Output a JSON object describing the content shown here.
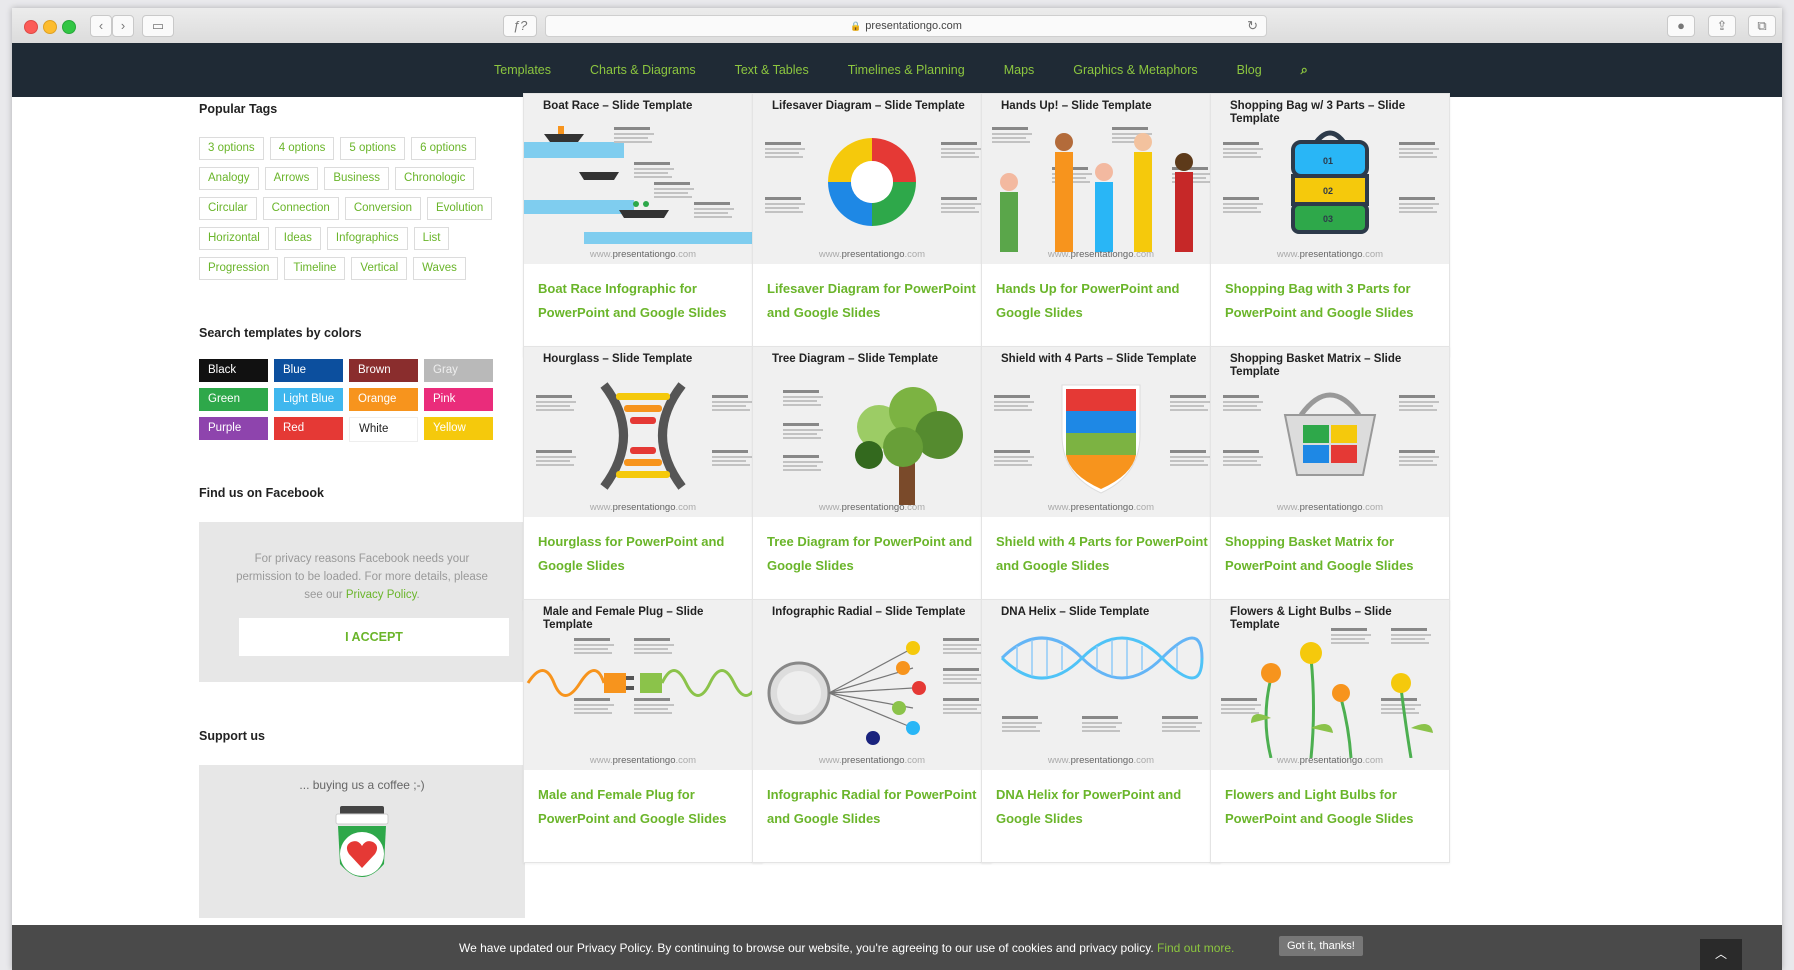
{
  "browser": {
    "url": "presentationgo.com",
    "colors": {
      "close": "#fc5b57",
      "minimize": "#fdbc2e",
      "maximize": "#32c644"
    }
  },
  "nav": {
    "items": [
      "Templates",
      "Charts & Diagrams",
      "Text & Tables",
      "Timelines & Planning",
      "Maps",
      "Graphics & Metaphors",
      "Blog"
    ],
    "search_icon": "search-icon",
    "colors": {
      "background": "#1f2a35",
      "link": "#8cc63f"
    }
  },
  "sidebar": {
    "popular_tags_title": "Popular Tags",
    "tags": [
      [
        "3 options",
        "4 options",
        "5 options",
        "6 options"
      ],
      [
        "Analogy",
        "Arrows",
        "Business",
        "Chronologic"
      ],
      [
        "Circular",
        "Connection",
        "Conversion",
        "Evolution"
      ],
      [
        "Horizontal",
        "Ideas",
        "Infographics",
        "List"
      ],
      [
        "Progression",
        "Timeline",
        "Vertical",
        "Waves"
      ]
    ],
    "colors_title": "Search templates by colors",
    "colors": [
      {
        "label": "Black",
        "bg": "#111111",
        "fg": "#ffffff"
      },
      {
        "label": "Blue",
        "bg": "#0c4f9e",
        "fg": "#ffffff"
      },
      {
        "label": "Brown",
        "bg": "#8a2d2d",
        "fg": "#ffffff"
      },
      {
        "label": "Gray",
        "bg": "#b9b9b9",
        "fg": "#eeeeee"
      },
      {
        "label": "Green",
        "bg": "#2ea84a",
        "fg": "#ffffff"
      },
      {
        "label": "Light Blue",
        "bg": "#3fb7ee",
        "fg": "#ffffff"
      },
      {
        "label": "Orange",
        "bg": "#f7941d",
        "fg": "#ffffff"
      },
      {
        "label": "Pink",
        "bg": "#ea2c7b",
        "fg": "#ffffff"
      },
      {
        "label": "Purple",
        "bg": "#8e44ad",
        "fg": "#ffffff"
      },
      {
        "label": "Red",
        "bg": "#e53935",
        "fg": "#ffffff"
      },
      {
        "label": "White",
        "bg": "#ffffff",
        "fg": "#222222"
      },
      {
        "label": "Yellow",
        "bg": "#f5c90c",
        "fg": "#ffffff"
      }
    ],
    "facebook_title": "Find us on Facebook",
    "facebook_text_1": "For privacy reasons Facebook needs your permission to be loaded. For more details, please see our",
    "facebook_link": "Privacy Policy",
    "facebook_text_2": ".",
    "accept_label": "I ACCEPT",
    "support_title": "Support us",
    "support_text": "... buying us a coffee ;-)"
  },
  "cards": [
    {
      "title": "Boat Race – Slide Template",
      "link": "Boat Race Infographic for PowerPoint and Google Slides",
      "kind": "boat"
    },
    {
      "title": "Lifesaver Diagram – Slide Template",
      "link": "Lifesaver Diagram for PowerPoint and Google Slides",
      "kind": "lifesaver"
    },
    {
      "title": "Hands Up! – Slide Template",
      "link": "Hands Up for PowerPoint and Google Slides",
      "kind": "hands"
    },
    {
      "title": "Shopping Bag w/ 3 Parts – Slide Template",
      "link": "Shopping Bag with 3 Parts for PowerPoint and Google Slides",
      "kind": "bag"
    },
    {
      "title": "Hourglass – Slide Template",
      "link": "Hourglass for PowerPoint and Google Slides",
      "kind": "hourglass"
    },
    {
      "title": "Tree Diagram – Slide Template",
      "link": "Tree Diagram for PowerPoint and Google Slides",
      "kind": "tree"
    },
    {
      "title": "Shield with 4 Parts – Slide Template",
      "link": "Shield with 4 Parts for PowerPoint and Google Slides",
      "kind": "shield"
    },
    {
      "title": "Shopping Basket Matrix – Slide Template",
      "link": "Shopping Basket Matrix for PowerPoint and Google Slides",
      "kind": "basket"
    },
    {
      "title": "Male and Female Plug – Slide Template",
      "link": "Male and Female Plug for PowerPoint and Google Slides",
      "kind": "plug"
    },
    {
      "title": "Infographic Radial – Slide Template",
      "link": "Infographic Radial for PowerPoint and Google Slides",
      "kind": "radial"
    },
    {
      "title": "DNA Helix – Slide Template",
      "link": "DNA Helix for PowerPoint and Google Slides",
      "kind": "dna"
    },
    {
      "title": "Flowers & Light Bulbs – Slide Template",
      "link": "Flowers and Light Bulbs for PowerPoint and Google Slides",
      "kind": "flowers"
    }
  ],
  "watermark": {
    "prefix": "www.",
    "brand": "presentationgo",
    ".suffix": ".com"
  },
  "cookie_bar": {
    "message": "We have updated our Privacy Policy. By continuing to browse our website, you're agreeing to our use of cookies and privacy policy.",
    "link": "Find out more.",
    "button": "Got it, thanks!",
    "scroll_top_icon": "chevron-up-icon"
  }
}
